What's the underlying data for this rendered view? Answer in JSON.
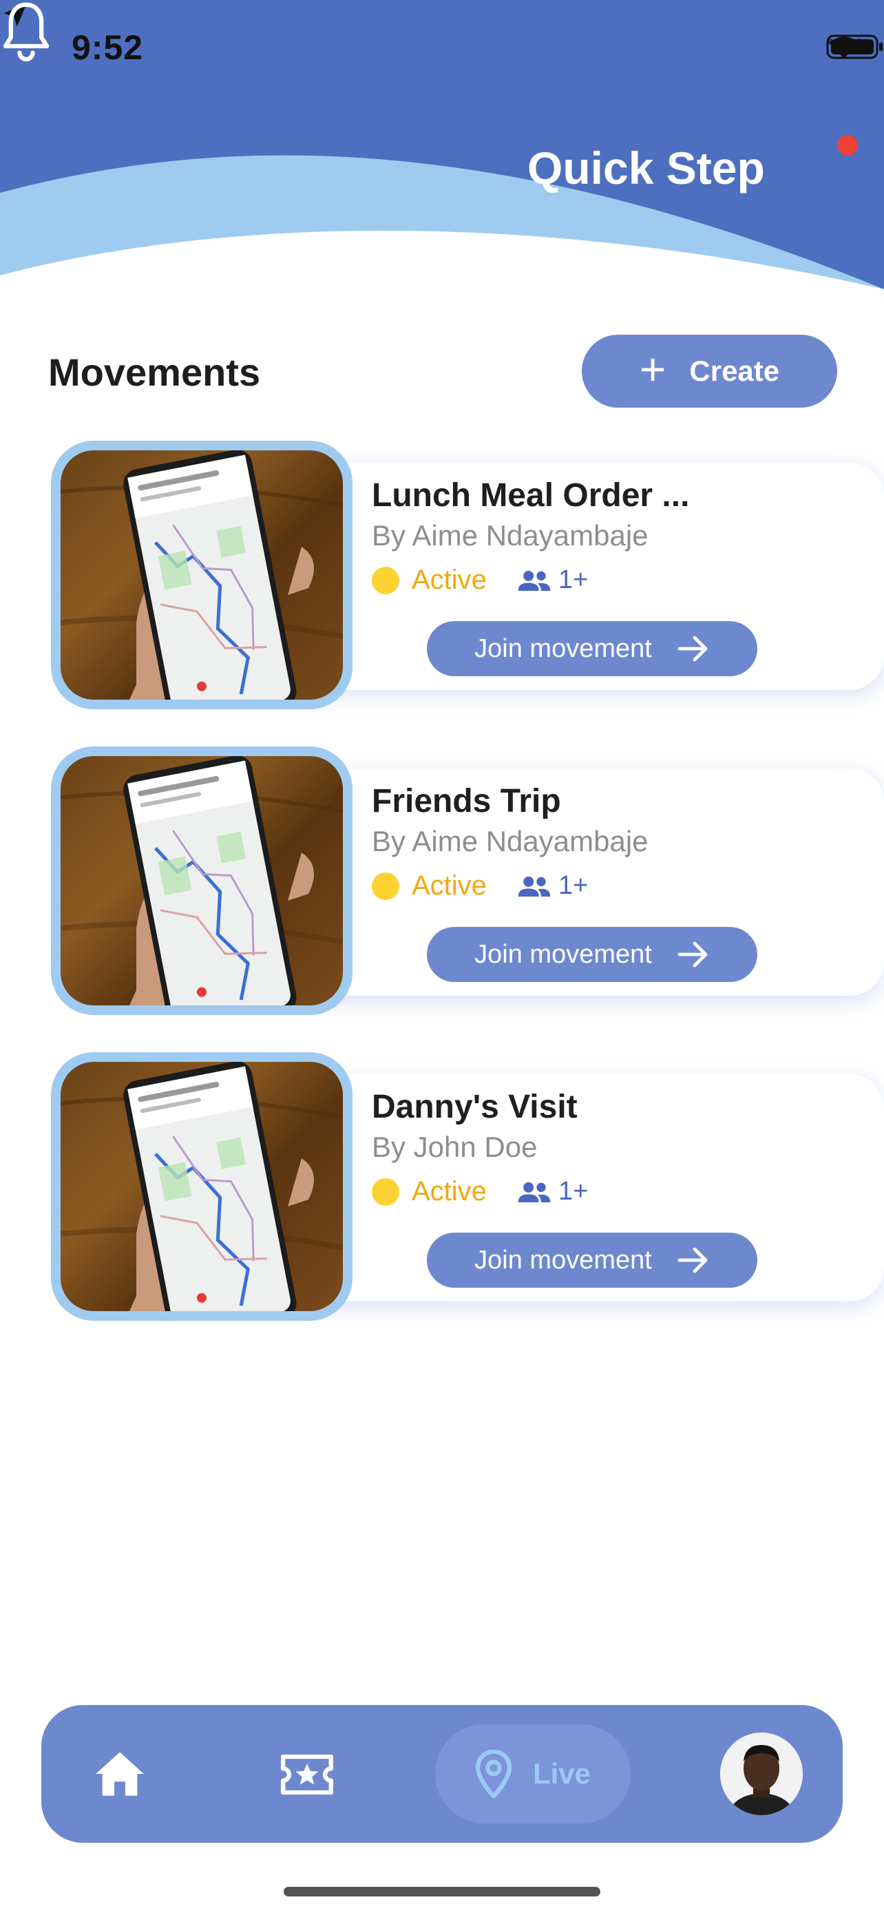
{
  "status_bar": {
    "time": "9:52"
  },
  "header": {
    "title": "Quick Step"
  },
  "section": {
    "title": "Movements",
    "create_label": "Create"
  },
  "movements": [
    {
      "title": "Lunch Meal Order ...",
      "author": "By Aime Ndayambaje",
      "status": "Active",
      "count": "1+",
      "action": "Join movement"
    },
    {
      "title": "Friends Trip",
      "author": "By Aime Ndayambaje",
      "status": "Active",
      "count": "1+",
      "action": "Join movement"
    },
    {
      "title": "Danny's Visit",
      "author": "By John Doe",
      "status": "Active",
      "count": "1+",
      "action": "Join movement"
    }
  ],
  "nav": {
    "live_label": "Live"
  },
  "colors": {
    "primary": "#4e6fbf",
    "accent": "#6e88cf",
    "light_blue": "#9fcbf0",
    "active": "#f4a70e",
    "notification": "#ef4138"
  },
  "icons": [
    "location-arrow-icon",
    "cellular-icon",
    "wifi-icon",
    "battery-icon",
    "bell-icon",
    "plus-icon",
    "people-icon",
    "arrow-right-icon",
    "home-icon",
    "ticket-star-icon",
    "location-pin-icon"
  ]
}
